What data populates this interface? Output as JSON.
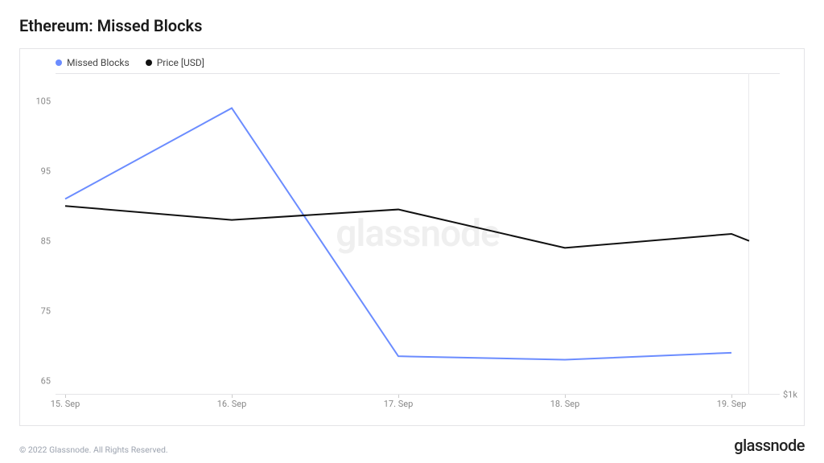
{
  "title": "Ethereum: Missed Blocks",
  "legend": {
    "series1": "Missed Blocks",
    "series2": "Price [USD]"
  },
  "watermark": "glassnode",
  "brand": "glassnode",
  "copyright": "© 2022 Glassnode. All Rights Reserved.",
  "y2_label": "$1k",
  "chart_data": {
    "type": "line",
    "categories": [
      "15. Sep",
      "16. Sep",
      "17. Sep",
      "18. Sep",
      "19. Sep"
    ],
    "series": [
      {
        "name": "Missed Blocks",
        "values": [
          91,
          104,
          68.5,
          68,
          69
        ],
        "color": "#6b8cff",
        "axis": "left"
      },
      {
        "name": "Price [USD]",
        "values": [
          90,
          88,
          89.5,
          84,
          86
        ],
        "color": "#111111",
        "axis": "left-as-overlay"
      }
    ],
    "y_ticks": [
      65,
      75,
      85,
      95,
      105
    ],
    "ylim": [
      63,
      109
    ],
    "title": "Ethereum: Missed Blocks",
    "xlabel": "",
    "ylabel": ""
  }
}
